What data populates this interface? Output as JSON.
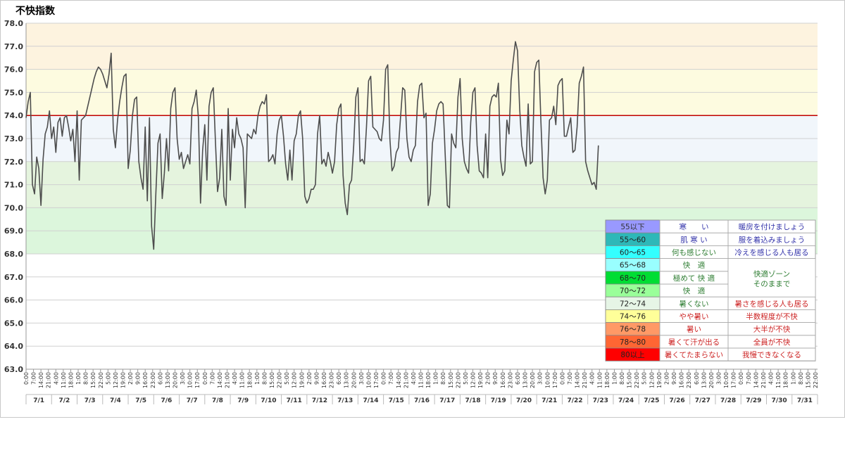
{
  "title": "不快指数",
  "colors": {
    "line": "#4d4d4d",
    "threshold": "#c00000",
    "band_hot": "#fdf3df",
    "band_warm": "#fdfbe0",
    "band_mild": "#f1f6fb",
    "band_comfort1": "#e5f4de",
    "band_comfort2": "#dcf6dc",
    "grid": "#d0d0d0"
  },
  "chart_data": {
    "type": "line",
    "title": "不快指数",
    "xlabel": "",
    "ylabel": "",
    "ylim": [
      63.0,
      78.0
    ],
    "yticks": [
      "63.0",
      "64.0",
      "65.0",
      "66.0",
      "67.0",
      "68.0",
      "69.0",
      "70.0",
      "71.0",
      "72.0",
      "73.0",
      "74.0",
      "75.0",
      "76.0",
      "77.0",
      "78.0"
    ],
    "threshold": 74.0,
    "bands": [
      {
        "from": 76,
        "to": 78,
        "color": "#fdf3df"
      },
      {
        "from": 74,
        "to": 76,
        "color": "#fdfbe0"
      },
      {
        "from": 72,
        "to": 74,
        "color": "#f1f6fb"
      },
      {
        "from": 70,
        "to": 72,
        "color": "#e5f4de"
      },
      {
        "from": 68,
        "to": 70,
        "color": "#dcf6dc"
      }
    ],
    "day_labels": [
      "7/1",
      "7/2",
      "7/3",
      "7/4",
      "7/5",
      "7/6",
      "7/7",
      "7/8",
      "7/9",
      "7/10",
      "7/11",
      "7/12",
      "7/13",
      "7/14",
      "7/15",
      "7/16",
      "7/17",
      "7/18",
      "7/19",
      "7/20",
      "7/21",
      "7/22",
      "7/23",
      "7/24",
      "7/25",
      "7/26",
      "7/27",
      "7/28",
      "7/29",
      "7/30",
      "7/31"
    ],
    "time_labels": [
      "0:00",
      "7:00",
      "14:00",
      "21:00",
      "4:00",
      "11:00",
      "18:00",
      "1:00",
      "8:00",
      "15:00",
      "22:00",
      "5:00",
      "12:00",
      "19:00",
      "2:00",
      "9:00",
      "16:00",
      "23:00",
      "6:00",
      "13:00",
      "20:00",
      "3:00",
      "10:00",
      "17:00",
      "0:00",
      "7:00",
      "14:00",
      "21:00",
      "4:00",
      "11:00",
      "18:00",
      "1:00",
      "8:00",
      "15:00",
      "22:00",
      "5:00",
      "12:00",
      "19:00",
      "2:00",
      "9:00",
      "16:00",
      "23:00",
      "6:00",
      "13:00",
      "20:00",
      "3:00",
      "10:00",
      "17:00",
      "0:00",
      "7:00",
      "14:00",
      "21:00",
      "4:00",
      "11:00",
      "18:00",
      "1:00",
      "8:00",
      "15:00",
      "22:00",
      "5:00",
      "12:00",
      "19:00",
      "2:00",
      "9:00",
      "16:00",
      "23:00",
      "6:00",
      "13:00",
      "20:00",
      "3:00",
      "10:00",
      "17:00",
      "0:00",
      "7:00",
      "14:00",
      "21:00",
      "4:00",
      "11:00",
      "18:00",
      "1:00",
      "8:00",
      "15:00",
      "22:00",
      "5:00",
      "12:00",
      "19:00",
      "2:00",
      "9:00",
      "16:00",
      "23:00",
      "6:00",
      "13:00",
      "20:00",
      "3:00",
      "10:00",
      "17:00",
      "0:00",
      "7:00",
      "14:00",
      "21:00",
      "4:00",
      "11:00",
      "18:00",
      "1:00",
      "8:00",
      "15:00",
      "22:00"
    ],
    "series": [
      {
        "step_hours": 2,
        "values": [
          73.9,
          74.6,
          75.0,
          71.0,
          70.6,
          72.2,
          71.7,
          70.1,
          72.1,
          73.2,
          73.5,
          74.2,
          73.0,
          73.5,
          72.4,
          73.7,
          73.9,
          73.1,
          73.9,
          74.0,
          73.5,
          72.9,
          73.4,
          72.0,
          74.2,
          71.2,
          73.8,
          73.9,
          74.0,
          74.4,
          74.8,
          75.2,
          75.6,
          75.9,
          76.1,
          76.0,
          75.8,
          75.5,
          75.2,
          75.8,
          76.7,
          73.4,
          72.6,
          73.8,
          74.6,
          75.2,
          75.7,
          75.8,
          71.7,
          72.5,
          74.0,
          74.7,
          74.8,
          72.0,
          71.3,
          70.8,
          73.5,
          70.3,
          73.9,
          69.2,
          68.2,
          70.6,
          72.8,
          73.2,
          70.4,
          71.5,
          73.0,
          71.6,
          74.3,
          75.0,
          75.2,
          73.0,
          72.1,
          72.4,
          71.7,
          72.0,
          72.3,
          71.9,
          74.3,
          74.6,
          75.1,
          73.9,
          70.2,
          72.5,
          73.6,
          71.2,
          74.4,
          75.0,
          75.2,
          72.9,
          70.7,
          71.3,
          73.4,
          70.5,
          70.1,
          74.3,
          71.2,
          73.4,
          72.6,
          73.9,
          73.2,
          73.0,
          72.6,
          70.0,
          73.2,
          73.1,
          73.0,
          73.4,
          73.2,
          74.0,
          74.4,
          74.6,
          74.5,
          74.9,
          72.0,
          72.1,
          72.3,
          71.9,
          73.2,
          73.8,
          74.0,
          73.1,
          71.9,
          71.2,
          72.5,
          71.2,
          72.9,
          73.2,
          74.0,
          74.2,
          73.0,
          70.5,
          70.2,
          70.4,
          70.8,
          70.8,
          71.0,
          73.2,
          74.0,
          71.9,
          72.1,
          71.8,
          72.4,
          72.0,
          71.5,
          72.0,
          73.6,
          74.3,
          74.5,
          71.4,
          70.2,
          69.7,
          71.0,
          71.2,
          72.7,
          74.8,
          75.2,
          72.0,
          72.1,
          71.9,
          73.5,
          75.5,
          75.7,
          73.5,
          73.4,
          73.3,
          73.0,
          72.9,
          73.8,
          76.0,
          76.2,
          73.0,
          71.6,
          71.8,
          72.4,
          72.6,
          73.9,
          75.2,
          75.1,
          73.0,
          72.2,
          72.0,
          72.5,
          72.7,
          74.6,
          75.3,
          75.4,
          73.9,
          74.1,
          70.1,
          70.6,
          72.8,
          73.4,
          74.2,
          74.5,
          74.6,
          74.5,
          72.3,
          70.1,
          70.0,
          73.2,
          72.8,
          72.6,
          74.8,
          75.6,
          73.0,
          72.0,
          71.7,
          71.5,
          73.7,
          75.0,
          75.2,
          72.7,
          71.6,
          71.5,
          71.3,
          73.2,
          71.3,
          74.4,
          74.8,
          74.9,
          74.8,
          75.4,
          72.1,
          71.4,
          71.6,
          73.8,
          73.2,
          75.5,
          76.4,
          77.2,
          76.8,
          74.3,
          72.7,
          72.2,
          71.8,
          74.5,
          71.9,
          72.0,
          75.9,
          76.3,
          76.4,
          73.7,
          71.3,
          70.6,
          71.2,
          73.8,
          73.9,
          74.4,
          73.6,
          75.3,
          75.5,
          75.6,
          73.1,
          73.1,
          73.5,
          73.9,
          72.4,
          72.5,
          73.5,
          75.4,
          75.7,
          76.1,
          72.0,
          71.6,
          71.3,
          71.0,
          71.1,
          70.8,
          72.7
        ]
      }
    ]
  },
  "legend": {
    "rows": [
      {
        "range": "55以下",
        "feeling": "寒　　い",
        "note": "暖房を付けましょう",
        "color": "#9999ff",
        "range_color": "#333333",
        "feeling_color": "#3333aa",
        "note_color": "#3333aa"
      },
      {
        "range": "55～60",
        "feeling": "肌 寒 い",
        "note": "服を着込みましょう",
        "color": "#2eb8b8",
        "range_color": "#222222",
        "feeling_color": "#3333aa",
        "note_color": "#3333aa"
      },
      {
        "range": "60～65",
        "feeling": "何も感じない",
        "note": "冷えを感じる人も居る",
        "color": "#33ffff",
        "range_color": "#222222",
        "feeling_color": "#2e7d32",
        "note_color": "#3333aa"
      },
      {
        "range": "65～68",
        "feeling": "快　適",
        "note": "",
        "color": "#99ffff",
        "range_color": "#222222",
        "feeling_color": "#2e7d32",
        "note_color": "#2e7d32"
      },
      {
        "range": "68～70",
        "feeling": "極めて 快 適",
        "note": "",
        "color": "#00dd33",
        "range_color": "#222222",
        "feeling_color": "#2e7d32",
        "note_color": "#2e7d32"
      },
      {
        "range": "70～72",
        "feeling": "快　適",
        "note": "",
        "color": "#99ff99",
        "range_color": "#222222",
        "feeling_color": "#2e7d32",
        "note_color": "#2e7d32"
      },
      {
        "range": "72～74",
        "feeling": "暑くない",
        "note": "暑さを感じる人も居る",
        "color": "#e6f5e6",
        "range_color": "#222222",
        "feeling_color": "#2e7d32",
        "note_color": "#cc2222"
      },
      {
        "range": "74～76",
        "feeling": "やや暑い",
        "note": "半数程度が不快",
        "color": "#ffff99",
        "range_color": "#222222",
        "feeling_color": "#cc2222",
        "note_color": "#cc2222"
      },
      {
        "range": "76～78",
        "feeling": "暑い",
        "note": "大半が不快",
        "color": "#ff9966",
        "range_color": "#222222",
        "feeling_color": "#cc2222",
        "note_color": "#cc2222"
      },
      {
        "range": "78～80",
        "feeling": "暑くて汗が出る",
        "note": "全員が不快",
        "color": "#ff6633",
        "range_color": "#222222",
        "feeling_color": "#cc2222",
        "note_color": "#cc2222"
      },
      {
        "range": "80以上",
        "feeling": "暑くてたまらない",
        "note": "我慢できなくなる",
        "color": "#ff0000",
        "range_color": "#222222",
        "feeling_color": "#cc2222",
        "note_color": "#cc2222"
      }
    ],
    "comfort_note_line1": "快適ゾーン",
    "comfort_note_line2": "そのままで"
  }
}
